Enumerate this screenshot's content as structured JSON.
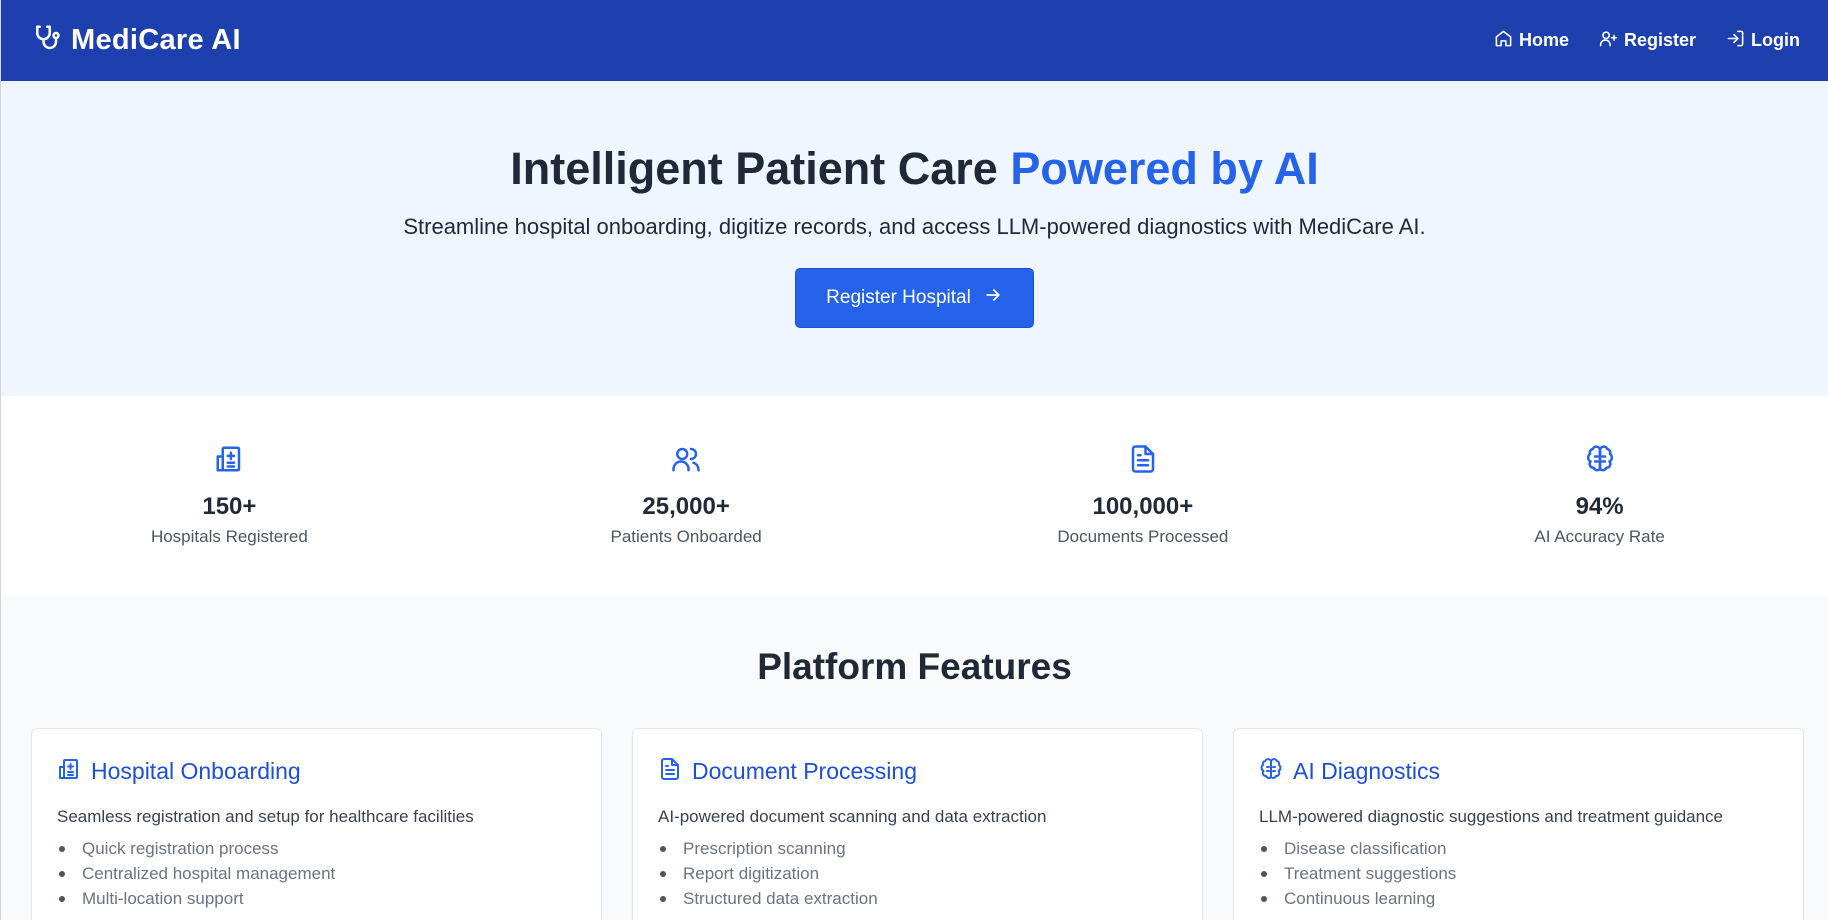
{
  "navbar": {
    "brand": "MediCare AI",
    "brand_icon": "stethoscope-icon",
    "links": [
      {
        "label": "Home",
        "icon": "home-icon"
      },
      {
        "label": "Register",
        "icon": "user-plus-icon"
      },
      {
        "label": "Login",
        "icon": "login-icon"
      }
    ]
  },
  "hero": {
    "title_main": "Intelligent Patient Care",
    "title_accent": "Powered by AI",
    "subtitle": "Streamline hospital onboarding, digitize records, and access LLM-powered diagnostics with MediCare AI.",
    "cta_label": "Register Hospital",
    "cta_icon": "arrow-right-icon"
  },
  "stats": [
    {
      "value": "150+",
      "label": "Hospitals Registered",
      "icon": "hospital-icon"
    },
    {
      "value": "25,000+",
      "label": "Patients Onboarded",
      "icon": "users-icon"
    },
    {
      "value": "100,000+",
      "label": "Documents Processed",
      "icon": "document-icon"
    },
    {
      "value": "94%",
      "label": "AI Accuracy Rate",
      "icon": "brain-icon"
    }
  ],
  "features": {
    "title": "Platform Features",
    "cards": [
      {
        "title": "Hospital Onboarding",
        "icon": "hospital-icon",
        "description": "Seamless registration and setup for healthcare facilities",
        "items": [
          "Quick registration process",
          "Centralized hospital management",
          "Multi-location support"
        ]
      },
      {
        "title": "Document Processing",
        "icon": "document-icon",
        "description": "AI-powered document scanning and data extraction",
        "items": [
          "Prescription scanning",
          "Report digitization",
          "Structured data extraction"
        ]
      },
      {
        "title": "AI Diagnostics",
        "icon": "brain-icon",
        "description": "LLM-powered diagnostic suggestions and treatment guidance",
        "items": [
          "Disease classification",
          "Treatment suggestions",
          "Continuous learning"
        ]
      }
    ]
  },
  "colors": {
    "navbar": "#1e40af",
    "accent": "#2563eb",
    "hero_bg": "#eff6ff",
    "page_bg": "#f8fafc"
  }
}
